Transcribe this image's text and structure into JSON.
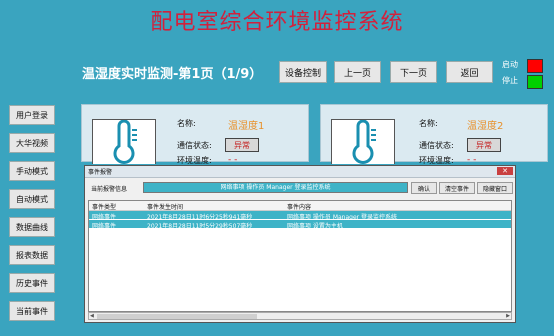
{
  "title": "配电室综合环境监控系统",
  "page_heading": "温湿度实时监测-第1页（1/9）",
  "top_buttons": [
    "设备控制",
    "上一页",
    "下一页",
    "返回"
  ],
  "status": {
    "start_label": "启动",
    "stop_label": "停止",
    "start_color": "#ff0000",
    "stop_color": "#00d000"
  },
  "sidebar": [
    "用户登录",
    "大华视频",
    "手动模式",
    "自动模式",
    "数据曲线",
    "报表数据",
    "历史事件",
    "当前事件"
  ],
  "cards": [
    {
      "name_label": "名称:",
      "name_value": "温湿度1",
      "comm_label": "通信状态:",
      "comm_value": "异常",
      "env_label": "环境温度:",
      "dash": "- -"
    },
    {
      "name_label": "名称:",
      "name_value": "温湿度2",
      "comm_label": "通信状态:",
      "comm_value": "异常",
      "env_label": "环境温度:",
      "dash": "- -"
    }
  ],
  "dialog": {
    "title": "事件报警",
    "current_alarm_label": "当前报警信息",
    "current_alarm_value": "网络事项 操作员 Manager 登录监控系统",
    "buttons": [
      "确认",
      "清空事件",
      "隐藏窗口"
    ],
    "close_glyph": "✕",
    "columns": [
      "事件类型",
      "事件发生时间",
      "事件内容"
    ],
    "rows": [
      [
        "网络事件",
        "2021年8月28日11时6分25秒941毫秒",
        "网络事项 操作员 Manager 登录监控系统"
      ],
      [
        "网络事件",
        "2021年8月28日11时5分29秒507毫秒",
        "网络事项 设置为主机"
      ]
    ]
  }
}
